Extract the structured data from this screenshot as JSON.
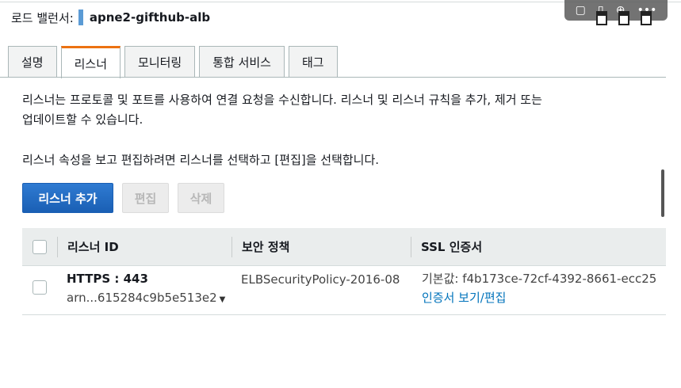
{
  "header": {
    "label": "로드 밸런서:",
    "name": "apne2-gifthub-alb"
  },
  "overlay": {
    "icons": [
      "comment-icon",
      "clipboard-icon",
      "download-icon",
      "more-icon"
    ],
    "glyphs": [
      "▢",
      "▯",
      "⊕",
      "•••"
    ]
  },
  "tabs": [
    {
      "label": "설명",
      "active": false
    },
    {
      "label": "리스너",
      "active": true
    },
    {
      "label": "모니터링",
      "active": false
    },
    {
      "label": "통합 서비스",
      "active": false
    },
    {
      "label": "태그",
      "active": false
    }
  ],
  "description": {
    "line1": "리스너는 프로토콜 및 포트를 사용하여 연결 요청을 수신합니다. 리스너 및 리스너 규칙을 추가, 제거 또는",
    "line2": "업데이트할 수 있습니다.",
    "line3": "리스너 속성을 보고 편집하려면 리스너를 선택하고 [편집]을 선택합니다."
  },
  "buttons": {
    "add": "리스너 추가",
    "edit": "편집",
    "delete": "삭제"
  },
  "table": {
    "headers": {
      "id": "리스너 ID",
      "policy": "보안 정책",
      "ssl": "SSL 인증서"
    },
    "rows": [
      {
        "protocol": "HTTPS : 443",
        "arn": "arn...615284c9b5e513e2",
        "policy": "ELBSecurityPolicy-2016-08",
        "ssl_default": "기본값:  f4b173ce-72cf-4392-8661-ecc25",
        "ssl_link": "인증서 보기/편집"
      }
    ]
  },
  "colors": {
    "accent": "#ec7211",
    "primary_button": "#1a5fb4",
    "link": "#0073bb"
  }
}
